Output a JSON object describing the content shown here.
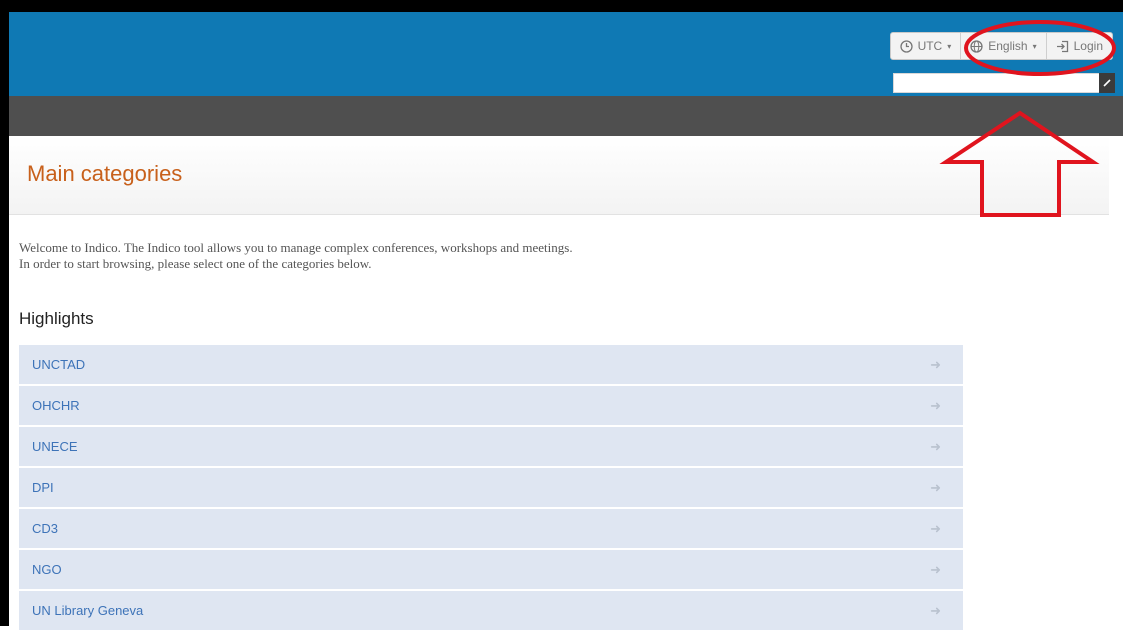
{
  "header": {
    "toolbar": {
      "timezone_label": "UTC",
      "language_label": "English",
      "login_label": "Login"
    },
    "search": {
      "placeholder": ""
    }
  },
  "main": {
    "title": "Main categories",
    "welcome_line1": "Welcome to Indico. The Indico tool allows you to manage complex conferences, workshops and meetings.",
    "welcome_line2": "In order to start browsing, please select one of the categories below.",
    "highlights_heading": "Highlights",
    "categories": [
      {
        "label": "UNCTAD"
      },
      {
        "label": "OHCHR"
      },
      {
        "label": "UNECE"
      },
      {
        "label": "DPI"
      },
      {
        "label": "CD3"
      },
      {
        "label": "NGO"
      },
      {
        "label": "UN Library Geneva"
      }
    ]
  },
  "icons": {
    "timezone": "clock-icon",
    "language": "globe-icon",
    "login": "login-icon",
    "search": "search-icon",
    "category_arrow": "arrow-right-icon"
  },
  "colors": {
    "header_blue": "#0f79b4",
    "navbar_gray": "#4f4f4f",
    "title_orange": "#c8601b",
    "category_bg": "#dfe6f2",
    "category_text": "#3d73b8",
    "annotation_red": "#e0141e"
  }
}
